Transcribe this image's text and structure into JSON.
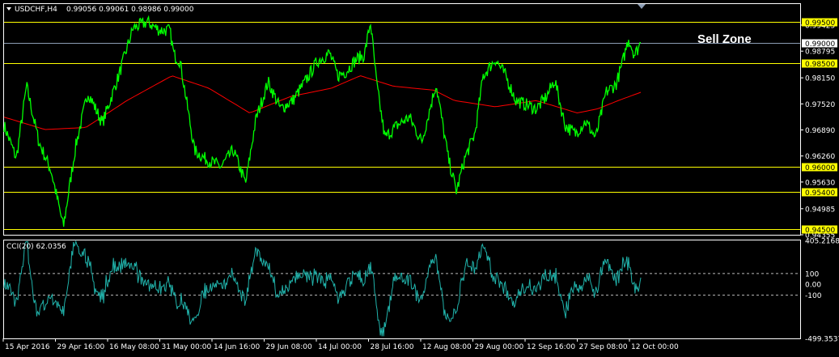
{
  "header": {
    "symbol": "USDCHF,H4",
    "ohlc": "0.99056 0.99061 0.98986 0.99000",
    "dropdown_icon": "triangle-down-icon"
  },
  "annotation": {
    "text": "Sell Zone"
  },
  "indicator": {
    "label": "CCI(20) 62.0356"
  },
  "colors": {
    "background": "#000000",
    "price": "#00ff00",
    "moving_average": "#ff0000",
    "level_line": "#ffff00",
    "current_price_line": "#8c9db4",
    "cci": "#20b2aa",
    "axis": "#ffffff",
    "level_label_bg": "#ffff00"
  },
  "chart_data": [
    {
      "type": "line",
      "ylim": [
        0.94355,
        0.99934
      ],
      "price_ticks": [
        "0.99425",
        "0.98795",
        "0.98150",
        "0.97520",
        "0.96890",
        "0.96260",
        "0.95630",
        "0.94985",
        "0.94355"
      ],
      "level_lines": [
        "0.99500",
        "0.98500",
        "0.96000",
        "0.95400",
        "0.94500"
      ],
      "current_price": "0.99000",
      "time_ticks": [
        "15 Apr 2016",
        "29 Apr 16:00",
        "16 May 08:00",
        "31 May 00:00",
        "14 Jun 16:00",
        "29 Jun 08:00",
        "14 Jul 00:00",
        "28 Jul 16:00",
        "12 Aug 08:00",
        "29 Aug 00:00",
        "12 Sep 16:00",
        "27 Sep 08:00",
        "12 Oct 00:00"
      ],
      "anchors": [
        [
          0,
          0.97
        ],
        [
          0.03,
          0.962
        ],
        [
          0.055,
          0.9795
        ],
        [
          0.085,
          0.966
        ],
        [
          0.115,
          0.959
        ],
        [
          0.145,
          0.9455
        ],
        [
          0.175,
          0.965
        ],
        [
          0.205,
          0.978
        ],
        [
          0.24,
          0.9705
        ],
        [
          0.28,
          0.982
        ],
        [
          0.315,
          0.9935
        ],
        [
          0.35,
          0.995
        ],
        [
          0.38,
          0.993
        ],
        [
          0.405,
          0.993
        ],
        [
          0.415,
          0.987
        ],
        [
          0.43,
          0.9855
        ],
        [
          0.465,
          0.964
        ],
        [
          0.49,
          0.962
        ],
        [
          0.53,
          0.96
        ],
        [
          0.56,
          0.964
        ],
        [
          0.59,
          0.956
        ],
        [
          0.615,
          0.9715
        ],
        [
          0.645,
          0.9805
        ],
        [
          0.675,
          0.974
        ],
        [
          0.705,
          0.976
        ],
        [
          0.735,
          0.9805
        ],
        [
          0.765,
          0.9855
        ],
        [
          0.795,
          0.9875
        ],
        [
          0.815,
          0.982
        ],
        [
          0.835,
          0.983
        ],
        [
          0.86,
          0.986
        ],
        [
          0.88,
          0.987
        ],
        [
          0.895,
          0.995
        ],
        [
          0.91,
          0.98
        ],
        [
          0.93,
          0.967
        ],
        [
          0.96,
          0.97
        ],
        [
          0.99,
          0.972
        ],
        [
          1.02,
          0.966
        ],
        [
          1.055,
          0.98
        ],
        [
          1.085,
          0.962
        ],
        [
          1.105,
          0.954
        ],
        [
          1.125,
          0.962
        ],
        [
          1.15,
          0.968
        ],
        [
          1.17,
          0.982
        ],
        [
          1.2,
          0.986
        ],
        [
          1.225,
          0.982
        ],
        [
          1.25,
          0.976
        ],
        [
          1.275,
          0.975
        ],
        [
          1.3,
          0.974
        ],
        [
          1.325,
          0.977
        ],
        [
          1.345,
          0.981
        ],
        [
          1.37,
          0.97
        ],
        [
          1.395,
          0.968
        ],
        [
          1.42,
          0.971
        ],
        [
          1.445,
          0.967
        ],
        [
          1.47,
          0.978
        ],
        [
          1.495,
          0.98
        ],
        [
          1.51,
          0.985
        ],
        [
          1.525,
          0.991
        ],
        [
          1.54,
          0.987
        ],
        [
          1.555,
          0.99
        ]
      ],
      "ma_anchors": [
        [
          0,
          0.972
        ],
        [
          0.1,
          0.969
        ],
        [
          0.2,
          0.9695
        ],
        [
          0.3,
          0.976
        ],
        [
          0.41,
          0.982
        ],
        [
          0.5,
          0.979
        ],
        [
          0.6,
          0.973
        ],
        [
          0.7,
          0.977
        ],
        [
          0.8,
          0.979
        ],
        [
          0.87,
          0.982
        ],
        [
          0.95,
          0.9795
        ],
        [
          1.05,
          0.9785
        ],
        [
          1.1,
          0.976
        ],
        [
          1.2,
          0.9745
        ],
        [
          1.3,
          0.976
        ],
        [
          1.4,
          0.973
        ],
        [
          1.45,
          0.974
        ],
        [
          1.5,
          0.976
        ],
        [
          1.555,
          0.978
        ]
      ]
    },
    {
      "type": "line",
      "ylim": [
        -499.3537,
        405.2168
      ],
      "y_ticks": [
        "405.2168",
        "100",
        "0.00",
        "-100",
        "-499.3537"
      ],
      "levels": [
        100,
        -100
      ],
      "current_value": 62.0356
    }
  ]
}
